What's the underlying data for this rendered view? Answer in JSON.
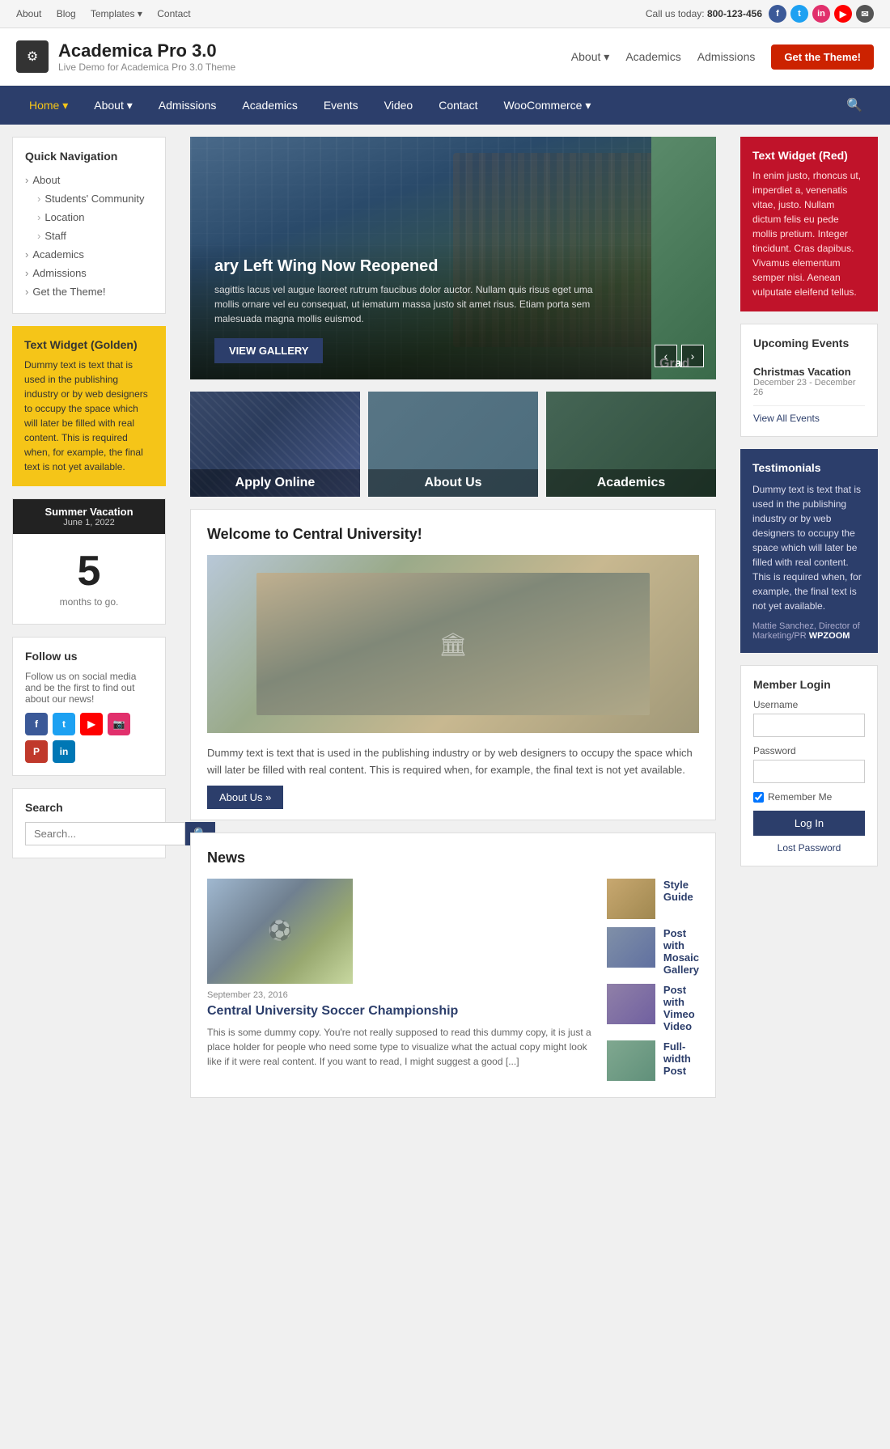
{
  "top_bar": {
    "links": [
      "About",
      "Blog",
      "Templates",
      "Contact"
    ],
    "call_label": "Call us today:",
    "call_number": "800-123-456"
  },
  "header": {
    "logo_icon": "⚙",
    "site_title": "Academica Pro 3.0",
    "site_subtitle": "Live Demo for Academica Pro 3.0 Theme",
    "nav_links": [
      "About",
      "Academics",
      "Admissions"
    ],
    "about_dropdown": "About ▾",
    "cta_label": "Get the Theme!"
  },
  "main_nav": {
    "links": [
      {
        "label": "Home ▾",
        "active": true
      },
      {
        "label": "About ▾",
        "active": false
      },
      {
        "label": "Admissions",
        "active": false
      },
      {
        "label": "Academics",
        "active": false
      },
      {
        "label": "Events",
        "active": false
      },
      {
        "label": "Video",
        "active": false
      },
      {
        "label": "Contact",
        "active": false
      },
      {
        "label": "WooCommerce ▾",
        "active": false
      }
    ]
  },
  "sidebar_left": {
    "quick_nav_title": "Quick Navigation",
    "quick_nav_items": [
      {
        "label": "About",
        "sub": false
      },
      {
        "label": "Students' Community",
        "sub": true
      },
      {
        "label": "Location",
        "sub": true
      },
      {
        "label": "Staff",
        "sub": true
      },
      {
        "label": "Academics",
        "sub": false
      },
      {
        "label": "Admissions",
        "sub": false
      },
      {
        "label": "Get the Theme!",
        "sub": false
      }
    ],
    "text_widget_title": "Text Widget (Golden)",
    "text_widget_text": "Dummy text is text that is used in the publishing industry or by web designers to occupy the space which will later be filled with real content. This is required when, for example, the final text is not yet available.",
    "countdown_title": "Summer Vacation",
    "countdown_date": "June 1, 2022",
    "countdown_number": "5",
    "countdown_label": "months to go.",
    "follow_title": "Follow us",
    "follow_desc": "Follow us on social media and be the first to find out about our news!",
    "search_title": "Search",
    "search_placeholder": "Search..."
  },
  "hero": {
    "title": "ary Left Wing Now Reopened",
    "description": "sagittis lacus vel augue laoreet rutrum faucibus dolor auctor. Nullam quis risus eget uma mollis ornare vel eu consequat, ut iematum massa justo sit amet risus. Etiam porta sem malesuada magna mollis euismod.",
    "btn_label": "VIEW GALLERY",
    "slide2_text": "Grad"
  },
  "feature_boxes": [
    {
      "label": "Apply Online"
    },
    {
      "label": "About Us"
    },
    {
      "label": "Academics"
    }
  ],
  "welcome": {
    "title": "Welcome to Central University!",
    "text": "Dummy text is text that is used in the publishing industry or by web designers to occupy the space which will later be filled with real content. This is required when, for example, the final text is not yet available.",
    "btn_label": "About Us »"
  },
  "news": {
    "section_title": "News",
    "main_news_date": "September 23, 2016",
    "main_news_title": "Central University Soccer Championship",
    "main_news_excerpt": "This is some dummy copy. You're not really supposed to read this dummy copy, it is just a place holder for people who need some type to visualize what the actual copy might look like if it were real content. If you want to read, I might suggest a good [...]",
    "sidebar_items": [
      {
        "title": "Style Guide"
      },
      {
        "title": "Post with Mosaic Gallery"
      },
      {
        "title": "Post with Vimeo Video"
      },
      {
        "title": "Full-width Post"
      }
    ]
  },
  "sidebar_right": {
    "text_widget_red_title": "Text Widget (Red)",
    "text_widget_red_text": "In enim justo, rhoncus ut, imperdiet a, venenatis vitae, justo. Nullam dictum felis eu pede mollis pretium. Integer tincidunt. Cras dapibus. Vivamus elementum semper nisi. Aenean vulputate eleifend tellus.",
    "events_title": "Upcoming Events",
    "event_title": "Christmas Vacation",
    "event_date": "December 23 - December 26",
    "view_all_label": "View All Events",
    "testimonials_title": "Testimonials",
    "testimonial_text": "Dummy text is text that is used in the publishing industry or by web designers to occupy the space which will later be filled with real content. This is required when, for example, the final text is not yet available.",
    "testimonial_author": "Mattie Sanchez, Director of Marketing/PR",
    "testimonial_brand": "WPZOOM",
    "member_login_title": "Member Login",
    "username_label": "Username",
    "password_label": "Password",
    "remember_label": "Remember Me",
    "login_btn": "Log In",
    "lost_password": "Lost Password"
  }
}
